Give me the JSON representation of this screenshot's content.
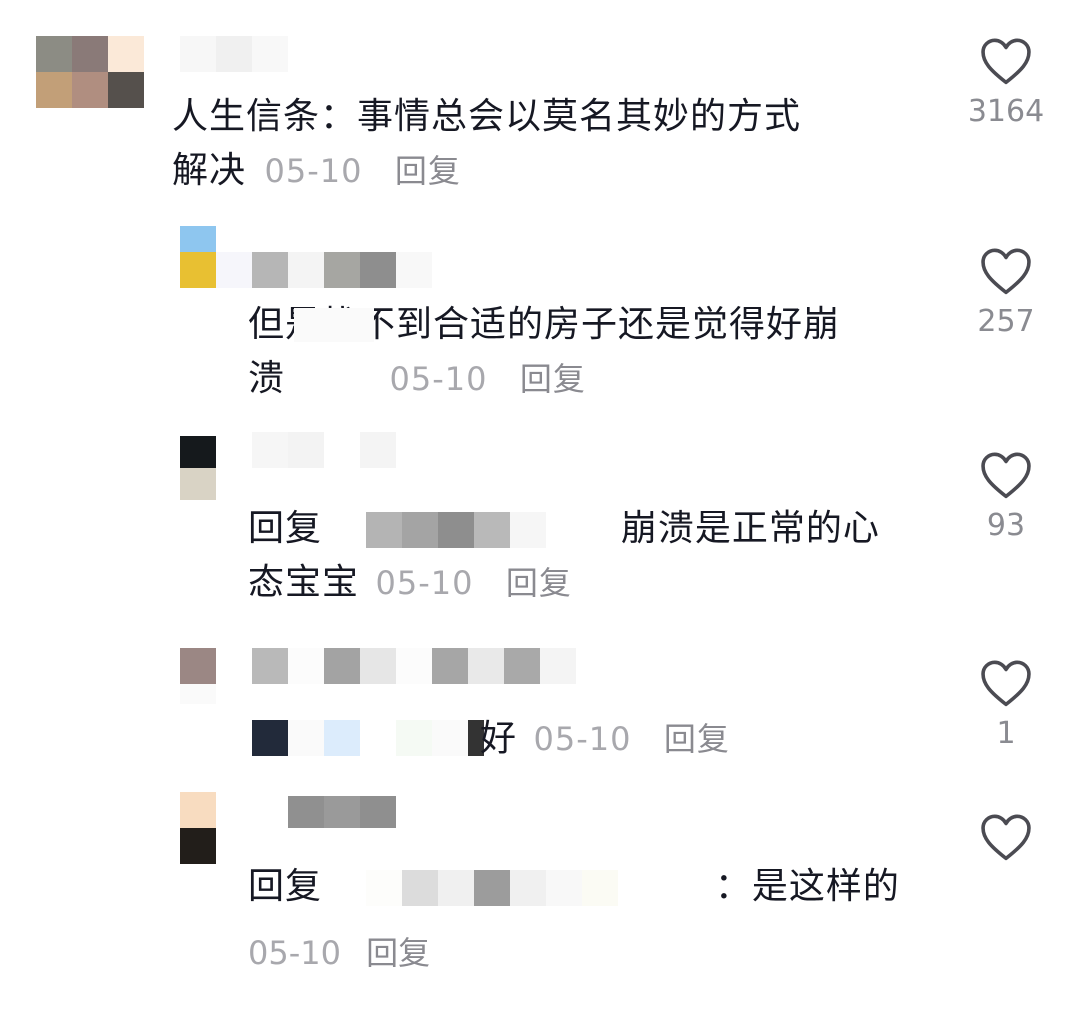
{
  "comments": [
    {
      "text_line1": "人生信条：事情总会以莫名其妙的方式",
      "text_line2": "解决",
      "date": "05-10",
      "reply": "回复",
      "likes": "3164"
    },
    {
      "text_line1": "但是找不到合适的房子还是觉得好崩",
      "text_line2": "溃",
      "date": "05-10",
      "reply": "回复",
      "likes": "257"
    },
    {
      "prefix": "回复",
      "text_line1": "崩溃是正常的心",
      "text_line2": "态宝宝",
      "date": "05-10",
      "reply": "回复",
      "likes": "93"
    },
    {
      "text": "好",
      "date": "05-10",
      "reply": "回复",
      "likes": "1"
    },
    {
      "prefix": "回复",
      "text": "：是这样的",
      "date": "05-10",
      "reply": "回复"
    }
  ],
  "icons": {
    "like": "heart-outline-icon"
  },
  "colors": {
    "text": "#161823",
    "meta": "#a8a8ad",
    "icon": "#4b4b52"
  }
}
